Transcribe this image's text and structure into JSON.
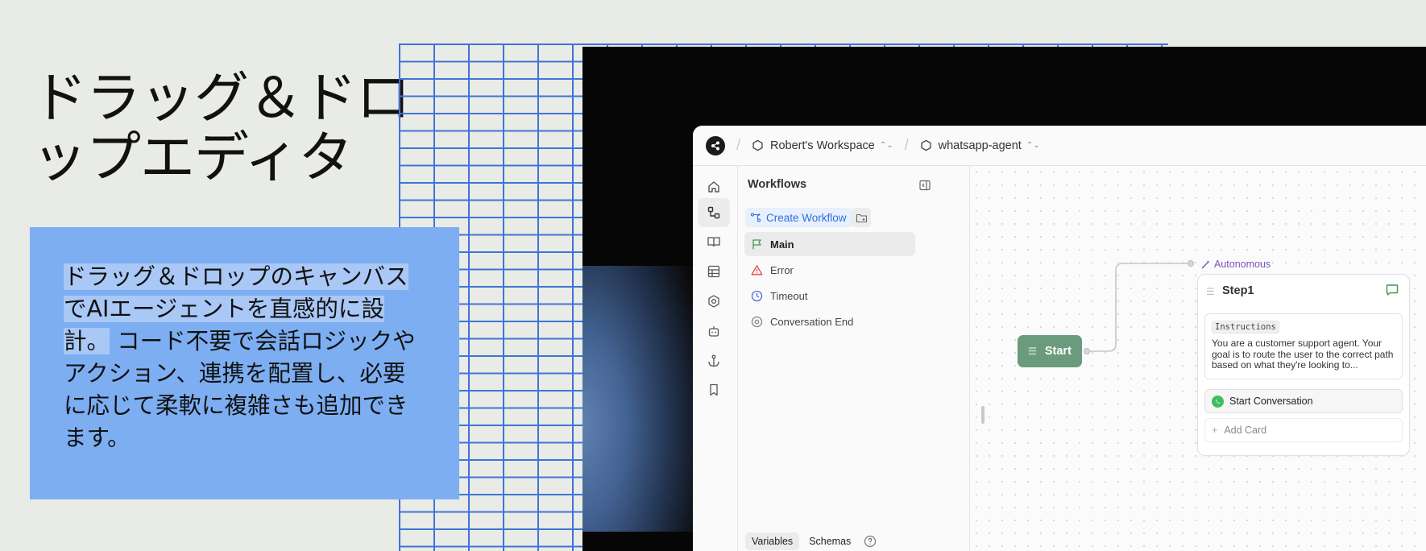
{
  "hero": {
    "title": "ドラッグ＆ドロップエディタ",
    "description_highlighted": "ドラッグ＆ドロップのキャンバスでAIエージェントを直感的に設計。",
    "description_rest": " コード不要で会話ロジックやアクション、連携を配置し、必要に応じて柔軟に複雑さも追加できます。"
  },
  "colors": {
    "grid_line": "#3f74d6",
    "desc_box": "#7daef2",
    "desc_highlight": "#a9c8f6",
    "start_node": "#6a9b7c",
    "accent_blue": "#2f6fe0",
    "autonomous_purple": "#7a52c8",
    "whatsapp_green": "#3ebd62"
  },
  "app": {
    "breadcrumb": {
      "workspace": "Robert's Workspace",
      "agent": "whatsapp-agent"
    },
    "rail_icons": [
      "home-icon",
      "workflows-icon",
      "book-icon",
      "table-icon",
      "settings-icon",
      "bot-icon",
      "anchor-icon",
      "bookmark-icon"
    ],
    "sidebar": {
      "title": "Workflows",
      "create_label": "Create Workflow",
      "workflows": [
        {
          "label": "Main",
          "icon": "flag-icon"
        },
        {
          "label": "Error",
          "icon": "warning-icon"
        },
        {
          "label": "Timeout",
          "icon": "clock-icon"
        },
        {
          "label": "Conversation End",
          "icon": "stop-circle-icon"
        }
      ],
      "tabs": [
        "Variables",
        "Schemas"
      ]
    },
    "canvas": {
      "start_label": "Start",
      "step": {
        "mode_label": "Autonomous",
        "title": "Step1",
        "instructions_tag": "Instructions",
        "instructions_text": "You are a customer support agent. Your goal is to route the user to the correct path based on what they're looking to...",
        "action_card": "Start Conversation",
        "add_card": "Add Card"
      }
    }
  }
}
